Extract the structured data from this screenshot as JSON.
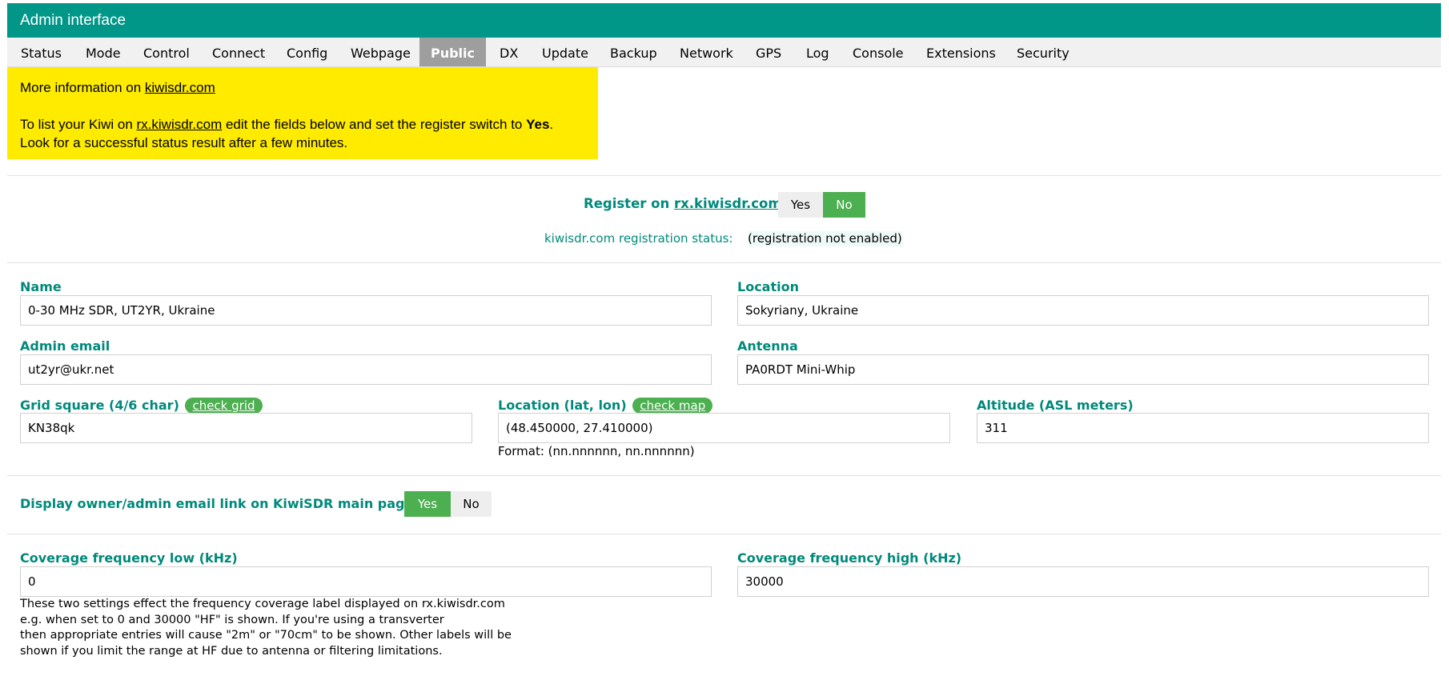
{
  "header": {
    "title": "Admin interface"
  },
  "nav": {
    "tabs": [
      {
        "label": "Status"
      },
      {
        "label": "Mode"
      },
      {
        "label": "Control"
      },
      {
        "label": "Connect"
      },
      {
        "label": "Config"
      },
      {
        "label": "Webpage"
      },
      {
        "label": "Public"
      },
      {
        "label": "DX"
      },
      {
        "label": "Update"
      },
      {
        "label": "Backup"
      },
      {
        "label": "Network"
      },
      {
        "label": "GPS"
      },
      {
        "label": "Log"
      },
      {
        "label": "Console"
      },
      {
        "label": "Extensions"
      },
      {
        "label": "Security"
      }
    ],
    "active": "Public"
  },
  "info": {
    "more_prefix": "More information on ",
    "more_link": "kiwisdr.com",
    "list_prefix": "To list your Kiwi on ",
    "list_link": "rx.kiwisdr.com",
    "list_mid": " edit the fields below and set the register switch to ",
    "list_bold": "Yes",
    "list_end": ".",
    "line3": "Look for a successful status result after a few minutes."
  },
  "register": {
    "prefix": "Register on ",
    "link": "rx.kiwisdr.com",
    "suffix": "?",
    "yes": "Yes",
    "no": "No",
    "selected": "No",
    "status_label": "kiwisdr.com registration status:",
    "status_value": "(registration not enabled)"
  },
  "fields": {
    "name": {
      "label": "Name",
      "value": "0-30 MHz SDR, UT2YR, Ukraine"
    },
    "location": {
      "label": "Location",
      "value": "Sokyriany, Ukraine"
    },
    "admin_email": {
      "label": "Admin email",
      "value": "ut2yr@ukr.net"
    },
    "antenna": {
      "label": "Antenna",
      "value": "PA0RDT Mini-Whip"
    },
    "grid": {
      "label": "Grid square (4/6 char)",
      "button": "check grid",
      "value": "KN38qk"
    },
    "latlon": {
      "label": "Location (lat, lon)",
      "button": "check map",
      "value": "(48.450000, 27.410000)",
      "format": "Format: (nn.nnnnnn, nn.nnnnnn)"
    },
    "altitude": {
      "label": "Altitude (ASL meters)",
      "value": "311"
    }
  },
  "display_email": {
    "label": "Display owner/admin email link on KiwiSDR main page?",
    "yes": "Yes",
    "no": "No",
    "selected": "Yes"
  },
  "coverage": {
    "low": {
      "label": "Coverage frequency low (kHz)",
      "value": "0"
    },
    "high": {
      "label": "Coverage frequency high (kHz)",
      "value": "30000"
    },
    "note": [
      "These two settings effect the frequency coverage label displayed on rx.kiwisdr.com",
      "e.g. when set to 0 and 30000 \"HF\" is shown. If you're using a transverter",
      "then appropriate entries will cause \"2m\" or \"70cm\" to be shown. Other labels will be",
      "shown if you limit the range at HF due to antenna or filtering limitations."
    ]
  },
  "colors": {
    "header": "#009688",
    "accent": "#00897b",
    "toggle_on": "#4caf50",
    "info_box": "#ffeb00",
    "active_tab": "#9e9e9e"
  }
}
